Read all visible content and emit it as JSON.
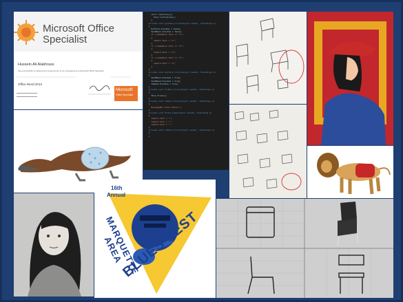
{
  "certificate": {
    "brand_line1": "Microsoft Office",
    "brand_line2": "Specialist",
    "recipient": "Hussein Ali Alakhrass",
    "body_text": "has successfully completed the requirements to be recognized as a Microsoft Office Specialist",
    "product": "Office Word 2013",
    "footer_logo": "Microsoft",
    "footer_sub": "Office Specialist"
  },
  "code": {
    "lines": [
      "    init: function(){",
      "      this.initialize();",
      "    }",
      "",
      "  private void pyramid_Click(object sender, EventArgs e)",
      "  {",
      "    button1.Visible = false;",
      "    textBox1.Visible = false;",
      "    if (comboBox1.Text == \"1\")",
      "    {",
      "      label1.Text = \"1\";",
      "    }",
      "    if (comboBox1.Text == \"2\")",
      "    {",
      "      label2.Text = \"2\";",
      "    }",
      "    if (comboBox1.Text == \"3\")",
      "    {",
      "      label3.Text = \"3\";",
      "    }",
      "  }",
      "",
      "  private void button1_Click(object sender, EventArgs e)",
      "  {",
      "    textBox1.Visible = true;",
      "    textBox2.Visible = true;",
      "    label4.Visible = true;",
      "  }",
      "",
      "  private void hidden_Click(object sender, EventArgs e)",
      "  {",
      "    this.Close();",
      "  }",
      "",
      "  private void label1_Click(object sender, EventArgs e)",
      "  {",
      "    MessageBox.Show(\"Hello\");",
      "  }",
      "",
      "  private void Form1_Load(object sender, EventArgs e)",
      "  {",
      "    label1.Text = \"\";",
      "    label2.Text = \"\";",
      "    label3.Text = \"\";",
      "  }",
      "",
      "  private void label2_Click(object sender, EventArgs e)",
      "  {",
      "  }"
    ]
  },
  "poster": {
    "top_line1": "16th",
    "top_line2": "Annual",
    "arc_text": "MARQUETTE AREA",
    "main_text": "BLUES FEST"
  },
  "colors": {
    "frame": "#1f3e72",
    "cert_orange": "#e8742a",
    "code_bg": "#1e1e1e",
    "portrait_red": "#c1272d",
    "poster_blue": "#1d3f8f",
    "poster_yellow": "#f5c21b"
  }
}
